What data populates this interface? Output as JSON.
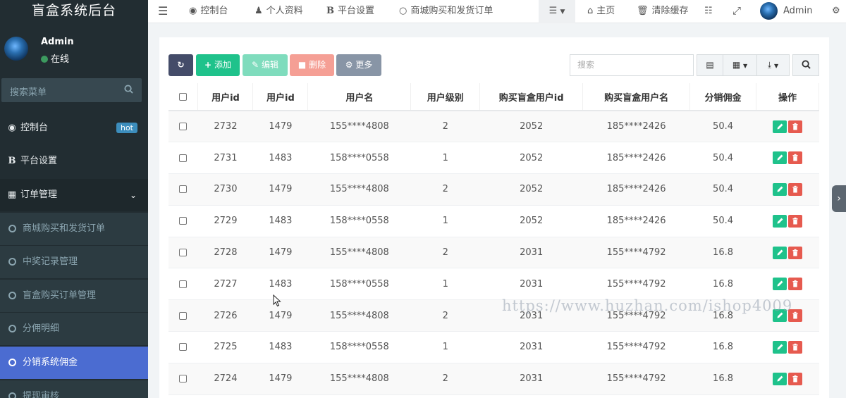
{
  "app": {
    "brand": "盲盒系统后台"
  },
  "user": {
    "name": "Admin",
    "status": "在线"
  },
  "sidebar": {
    "search_placeholder": "搜索菜单",
    "items": [
      {
        "label": "控制台",
        "badge": "hot",
        "icon": "dashboard-icon"
      },
      {
        "label": "平台设置",
        "icon": "bold-b-icon"
      },
      {
        "label": "订单管理",
        "icon": "calculator-icon"
      },
      {
        "label": "商城购买和发货订单",
        "icon": "circle-icon"
      },
      {
        "label": "中奖记录管理",
        "icon": "circle-icon"
      },
      {
        "label": "盲盒购买订单管理",
        "icon": "circle-icon"
      },
      {
        "label": "分佣明细",
        "icon": "circle-icon"
      },
      {
        "label": "分销系统佣金",
        "icon": "circle-icon",
        "active": true
      },
      {
        "label": "提现审核",
        "icon": "circle-icon"
      }
    ]
  },
  "navbar": {
    "tabs": [
      "控制台",
      "个人资料",
      "平台设置",
      "商城购买和发货订单"
    ],
    "home": "主页",
    "clear_cache": "清除缓存",
    "user": "Admin"
  },
  "toolbar": {
    "add": "添加",
    "edit": "编辑",
    "delete": "删除",
    "more": "更多",
    "search_placeholder": "搜索"
  },
  "table": {
    "columns": [
      "用户id",
      "用户id",
      "用户名",
      "用户级别",
      "购买盲盒用户id",
      "购买盲盒用户名",
      "分销佣金",
      "操作"
    ],
    "rows": [
      [
        "2732",
        "1479",
        "155****4808",
        "2",
        "2052",
        "185****2426",
        "50.4"
      ],
      [
        "2731",
        "1483",
        "158****0558",
        "1",
        "2052",
        "185****2426",
        "50.4"
      ],
      [
        "2730",
        "1479",
        "155****4808",
        "2",
        "2052",
        "185****2426",
        "50.4"
      ],
      [
        "2729",
        "1483",
        "158****0558",
        "1",
        "2052",
        "185****2426",
        "50.4"
      ],
      [
        "2728",
        "1479",
        "155****4808",
        "2",
        "2031",
        "155****4792",
        "16.8"
      ],
      [
        "2727",
        "1483",
        "158****0558",
        "1",
        "2031",
        "155****4792",
        "16.8"
      ],
      [
        "2726",
        "1479",
        "155****4808",
        "2",
        "2031",
        "155****4792",
        "16.8"
      ],
      [
        "2725",
        "1483",
        "158****0558",
        "1",
        "2031",
        "155****4792",
        "16.8"
      ],
      [
        "2724",
        "1479",
        "155****4808",
        "2",
        "2031",
        "155****4792",
        "16.8"
      ]
    ]
  },
  "watermark": "https://www.huzhan.com/ishop4009",
  "colors": {
    "sidebar": "#222d32",
    "active": "#4b6cd1",
    "success": "#1fc28b",
    "danger": "#e65a4f",
    "primary_dark": "#444c69"
  }
}
